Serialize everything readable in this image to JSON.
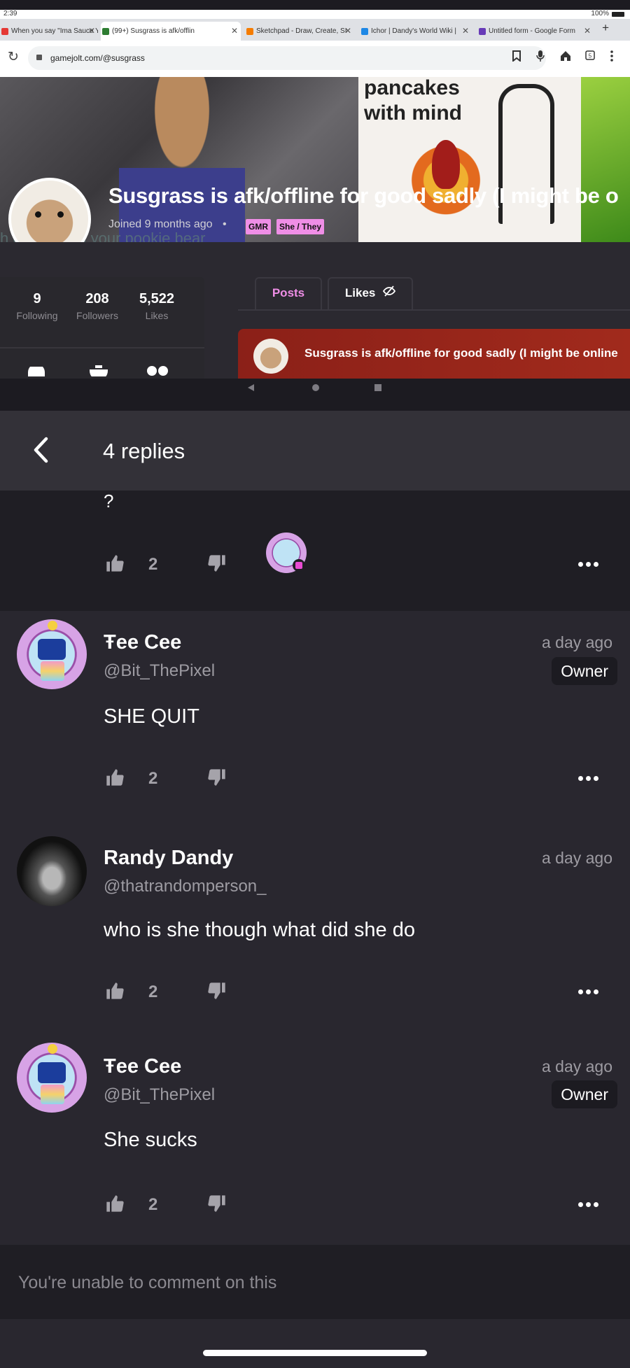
{
  "device": {
    "time": "2:39",
    "battery": "100%"
  },
  "browser": {
    "tabs": [
      {
        "title": "When you say \"Ima Sauce Y",
        "favicon_color": "#e53935"
      },
      {
        "title": "(99+) Susgrass is afk/offlin",
        "favicon_color": "#2e7d32"
      },
      {
        "title": "Sketchpad - Draw, Create, SI",
        "favicon_color": "#f57c00"
      },
      {
        "title": "Ichor | Dandy's World Wiki |",
        "favicon_color": "#1e88e5"
      },
      {
        "title": "Untitled form - Google Form",
        "favicon_color": "#673ab7"
      }
    ],
    "tab_close": "✕",
    "new_tab": "+",
    "reload_icon": "↻",
    "url": "gamejolt.com/@susgrass",
    "tab_count": "5"
  },
  "profile": {
    "banner_text": "pancakes\nwith mind",
    "name": "Susgrass is afk/offline for good sadly (I might be o",
    "joined": "Joined 9 months ago",
    "dot": "•",
    "badges": [
      "GMR",
      "She / They"
    ],
    "behind_text": "h    ot gay with your pookie bear",
    "stats": [
      {
        "value": "9",
        "label": "Following"
      },
      {
        "value": "208",
        "label": "Followers"
      },
      {
        "value": "5,522",
        "label": "Likes"
      }
    ],
    "tabs": [
      {
        "label": "Posts"
      },
      {
        "label": "Likes"
      }
    ],
    "post_title": "Susgrass is afk/offline for good sadly (I might be online"
  },
  "replies": {
    "header": "4 replies",
    "first": {
      "text": "?",
      "likes": "2"
    },
    "comments": [
      {
        "name": "Ŧee Cee",
        "handle": "@Bit_ThePixel",
        "time": "a day ago",
        "badge": "Owner",
        "text": "SHE QUIT",
        "likes": "2"
      },
      {
        "name": "Randy Dandy",
        "handle": "@thatrandomperson_",
        "time": "a day ago",
        "text": "who is she though what did she do",
        "likes": "2"
      },
      {
        "name": "Ŧee Cee",
        "handle": "@Bit_ThePixel",
        "time": "a day ago",
        "badge": "Owner",
        "text": "She sucks",
        "likes": "2"
      }
    ],
    "footer": "You're unable to comment on this"
  },
  "icons": {
    "back": "chevron-left-icon",
    "like": "thumbs-up-icon",
    "dislike": "thumbs-down-icon",
    "more": "more-horizontal-icon"
  },
  "colors": {
    "page_bg": "#29272f",
    "accent_pink": "#ef8ee6",
    "post_card_red": "#a12a1c"
  }
}
